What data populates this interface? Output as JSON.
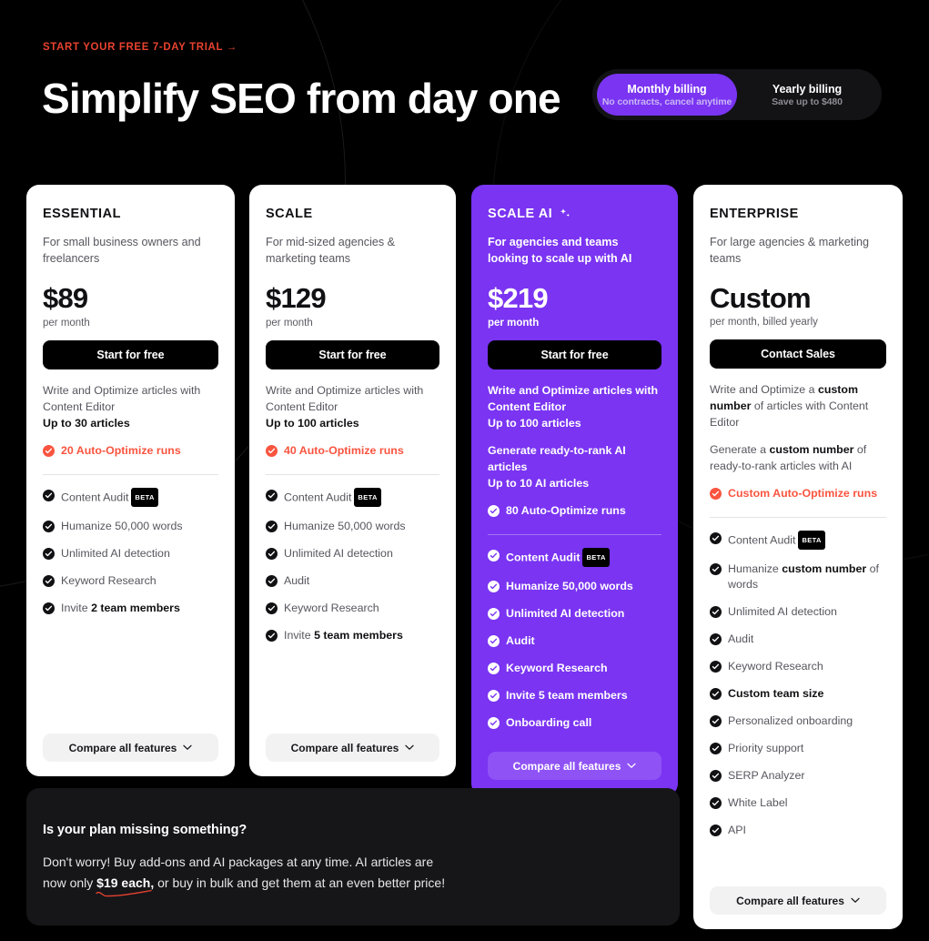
{
  "header": {
    "eyebrow": "START YOUR FREE 7-DAY TRIAL →",
    "headline": "Simplify SEO from day one"
  },
  "billing": {
    "monthly": {
      "label": "Monthly billing",
      "sub": "No contracts, cancel anytime",
      "active": true
    },
    "yearly": {
      "label": "Yearly billing",
      "sub": "Save up to $480",
      "active": false
    }
  },
  "colors": {
    "purple": "#7A34F2",
    "purple_light": "#8F52F5",
    "coral": "#F9543F",
    "eyebrow_red": "#E8422F",
    "page_bg": "#000000",
    "callout_bg": "#161619",
    "card_bg": "#FFFFFF",
    "muted_text": "#56565E"
  },
  "plans": [
    {
      "name": "ESSENTIAL",
      "desc": "For small business owners and freelancers",
      "price": "$89",
      "price_note": "per month",
      "cta": "Start for free",
      "blurbs": [
        {
          "text": "Write and Optimize articles with Content Editor",
          "bold": ""
        },
        {
          "text": "",
          "bold": "Up to 30 articles"
        }
      ],
      "accent": "20 Auto-Optimize runs",
      "features": [
        {
          "label": "Content Audit",
          "badge": "BETA",
          "bold": ""
        },
        {
          "label": "Humanize 50,000 words",
          "badge": "",
          "bold": ""
        },
        {
          "label": "Unlimited AI detection",
          "badge": "",
          "bold": ""
        },
        {
          "label": "Keyword Research",
          "badge": "",
          "bold": ""
        },
        {
          "label": "Invite ",
          "badge": "",
          "bold": "2 team members"
        }
      ],
      "compare": "Compare all features"
    },
    {
      "name": "SCALE",
      "desc": "For mid-sized agencies & marketing teams",
      "price": "$129",
      "price_note": "per month",
      "cta": "Start for free",
      "blurbs": [
        {
          "text": "Write and Optimize articles with Content Editor",
          "bold": ""
        },
        {
          "text": "",
          "bold": "Up to 100 articles"
        }
      ],
      "accent": "40 Auto-Optimize runs",
      "features": [
        {
          "label": "Content Audit",
          "badge": "BETA",
          "bold": ""
        },
        {
          "label": "Humanize 50,000 words",
          "badge": "",
          "bold": ""
        },
        {
          "label": "Unlimited AI detection",
          "badge": "",
          "bold": ""
        },
        {
          "label": "Audit",
          "badge": "",
          "bold": ""
        },
        {
          "label": "Keyword Research",
          "badge": "",
          "bold": ""
        },
        {
          "label": "Invite ",
          "badge": "",
          "bold": "5 team members"
        }
      ],
      "compare": "Compare all features"
    },
    {
      "name": "SCALE AI",
      "icon": "sparkle-icon",
      "desc": "For agencies and teams looking to scale up with AI",
      "price": "$219",
      "price_note": "per month",
      "cta": "Start for free",
      "blurbs": [
        {
          "text": "Write and Optimize articles with Content Editor",
          "bold": ""
        },
        {
          "text": "",
          "bold": "Up to 100 articles"
        },
        {
          "text": "Generate ready-to-rank AI articles",
          "bold": ""
        },
        {
          "text": "",
          "bold": "Up to 10 AI articles"
        }
      ],
      "accent": "80 Auto-Optimize runs",
      "features": [
        {
          "label": "Content Audit",
          "badge": "BETA",
          "bold": ""
        },
        {
          "label": "Humanize 50,000 words",
          "badge": "",
          "bold": ""
        },
        {
          "label": "Unlimited AI detection",
          "badge": "",
          "bold": ""
        },
        {
          "label": "Audit",
          "badge": "",
          "bold": ""
        },
        {
          "label": "Keyword Research",
          "badge": "",
          "bold": ""
        },
        {
          "label": "Invite ",
          "badge": "",
          "bold": "5 team members"
        },
        {
          "label": "Onboarding call",
          "badge": "",
          "bold": ""
        }
      ],
      "compare": "Compare all features",
      "highlighted": true
    },
    {
      "name": "ENTERPRISE",
      "desc": "For large agencies & marketing teams",
      "price": "Custom",
      "price_note": "per month, billed yearly",
      "cta": "Contact Sales",
      "blurbs": [
        {
          "pre": "Write and Optimize a ",
          "bold": "custom number",
          "post": " of articles with Content Editor"
        },
        {
          "pre": "Generate a ",
          "bold": "custom number",
          "post": " of ready-to-rank articles with AI"
        }
      ],
      "accent": "Custom Auto-Optimize runs",
      "features": [
        {
          "label": "Content Audit",
          "badge": "BETA",
          "bold": ""
        },
        {
          "pre": "Humanize ",
          "bold": "custom number",
          "post": " of words",
          "badge": ""
        },
        {
          "label": "Unlimited AI detection",
          "badge": "",
          "bold": ""
        },
        {
          "label": "Audit",
          "badge": "",
          "bold": ""
        },
        {
          "label": "Keyword Research",
          "badge": "",
          "bold": ""
        },
        {
          "label": "Custom team size",
          "badge": "",
          "bold": "",
          "strong": true
        },
        {
          "label": "Personalized onboarding",
          "badge": "",
          "bold": ""
        },
        {
          "label": "Priority support",
          "badge": "",
          "bold": ""
        },
        {
          "label": "SERP Analyzer",
          "badge": "",
          "bold": ""
        },
        {
          "label": "White Label",
          "badge": "",
          "bold": ""
        },
        {
          "label": "API",
          "badge": "",
          "bold": ""
        }
      ],
      "compare": "Compare all features"
    }
  ],
  "callout": {
    "title": "Is your plan missing something?",
    "line1": "Don't worry! Buy add-ons and AI packages at any time. AI articles are",
    "line2_pre": "now only ",
    "line2_bold": "$19 each,",
    "line2_post": " or buy in bulk and get them at an even better price!"
  }
}
